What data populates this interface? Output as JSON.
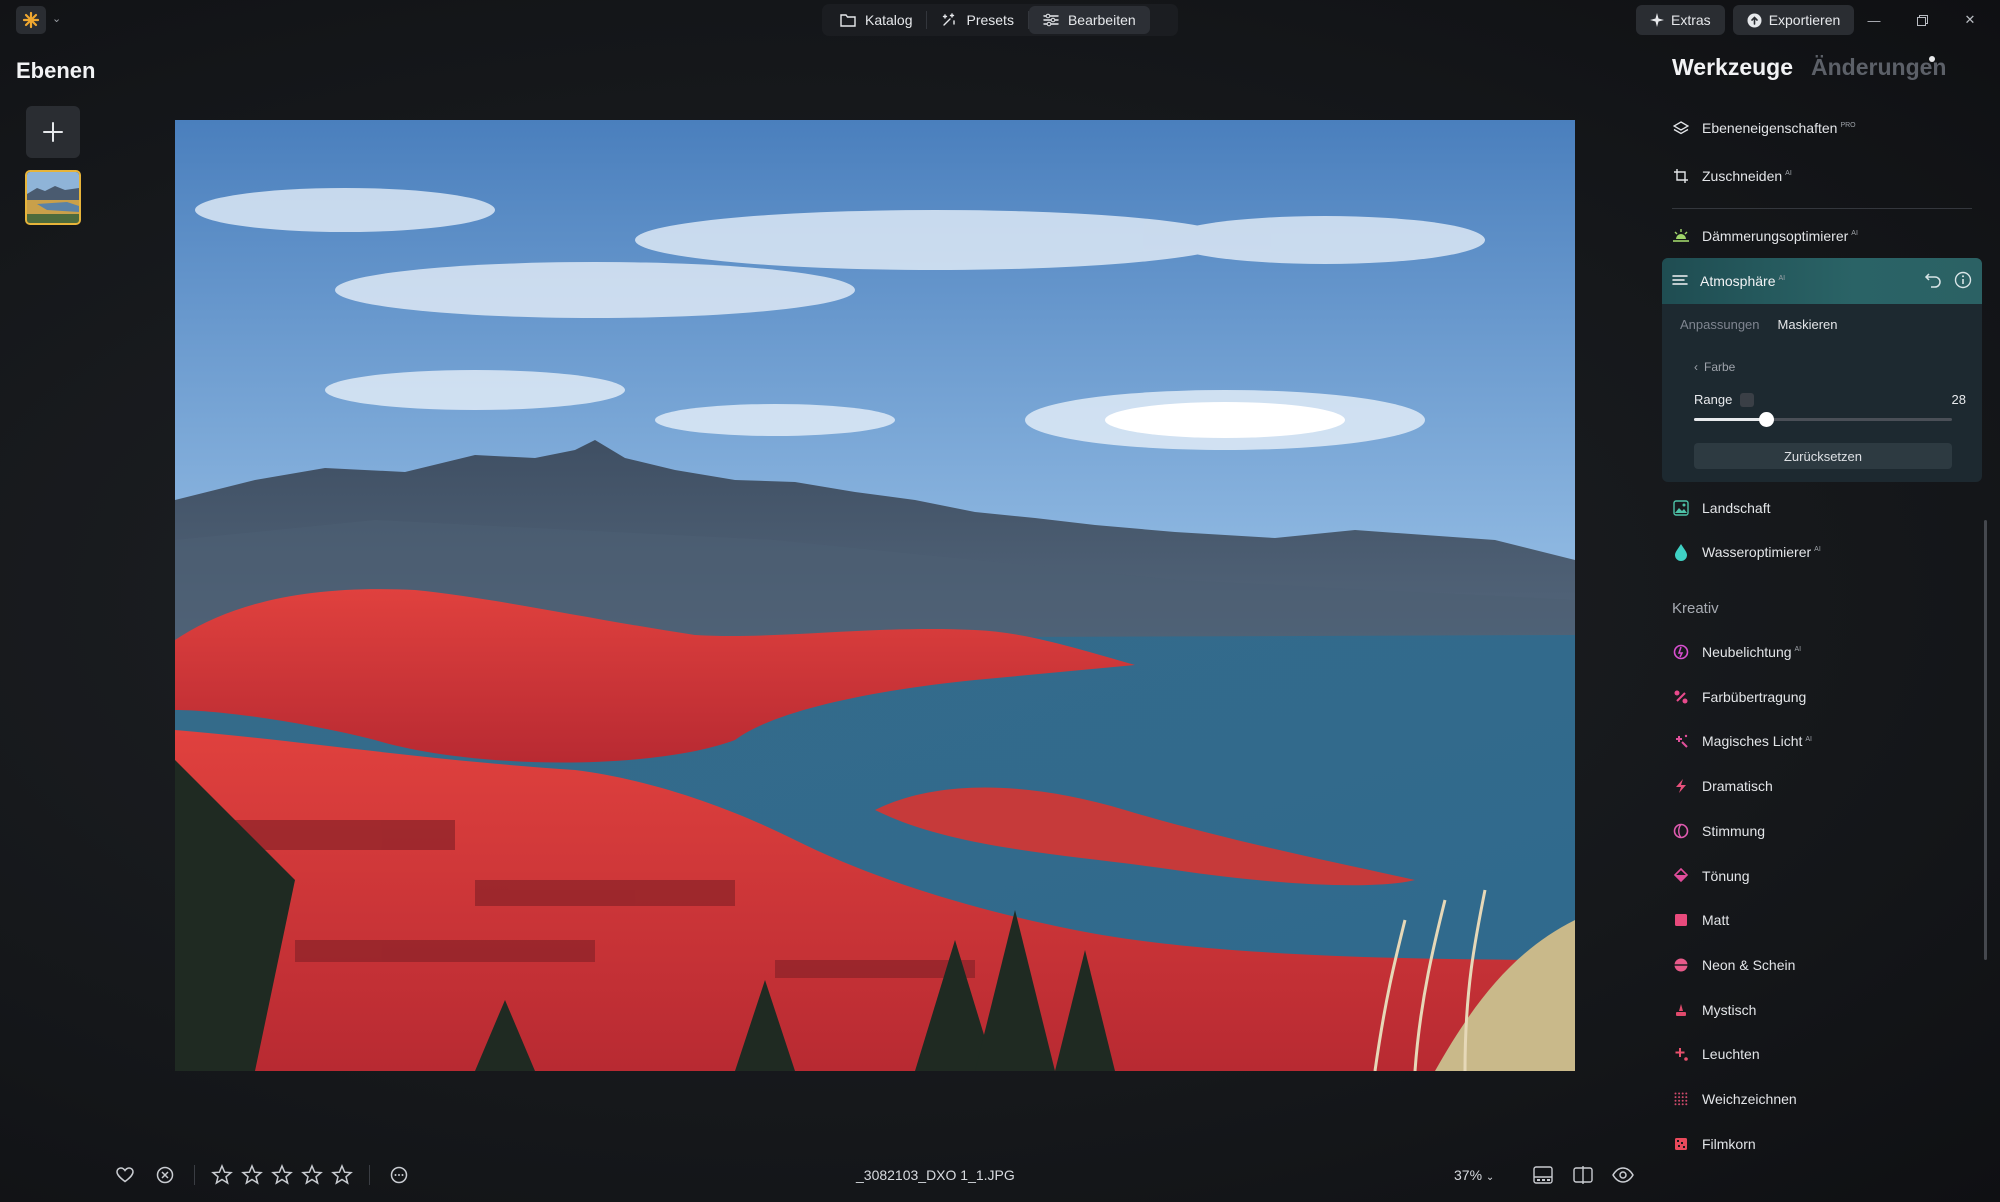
{
  "top_nav": {
    "items": [
      {
        "label": "Katalog",
        "icon": "folder-icon",
        "active": false
      },
      {
        "label": "Presets",
        "icon": "sparkle-icon",
        "active": false
      },
      {
        "label": "Bearbeiten",
        "icon": "sliders-icon",
        "active": true
      }
    ],
    "extras_label": "Extras",
    "export_label": "Exportieren"
  },
  "layers": {
    "title": "Ebenen"
  },
  "bottom_bar": {
    "filename": "_3082103_DXO 1_1.JPG",
    "zoom": "37%",
    "rating": 0
  },
  "right_panel": {
    "tabs": [
      {
        "label": "Werkzeuge",
        "active": true
      },
      {
        "label": "Änderungen",
        "active": false
      }
    ],
    "tools_top": [
      {
        "label": "Ebeneneigenschaften",
        "badge": "PRO",
        "icon": "layers-icon"
      },
      {
        "label": "Zuschneiden",
        "badge": "AI",
        "icon": "crop-icon"
      }
    ],
    "tools_mid": [
      {
        "label": "Dämmerungsoptimierer",
        "badge": "AI",
        "icon": "sunset-icon"
      }
    ],
    "atmosphere": {
      "title": "Atmosphäre",
      "badge": "AI",
      "subtabs": [
        "Anpassungen",
        "Maskieren"
      ],
      "active_subtab": "Maskieren",
      "back_label": "Farbe",
      "range_label": "Range",
      "range_value": "28",
      "range_fraction": 0.28,
      "reset_label": "Zurücksetzen"
    },
    "tools_after": [
      {
        "label": "Landschaft",
        "badge": "",
        "icon": "landscape-icon",
        "color": "#4ec3a8"
      },
      {
        "label": "Wasseroptimierer",
        "badge": "AI",
        "icon": "water-drop-icon",
        "color": "#3fd1c4"
      }
    ],
    "kreativ_label": "Kreativ",
    "kreativ_tools": [
      {
        "label": "Neubelichtung",
        "badge": "AI",
        "icon": "relight-icon",
        "color": "#d94fd0"
      },
      {
        "label": "Farbübertragung",
        "badge": "",
        "icon": "color-transfer-icon",
        "color": "#e84a8c"
      },
      {
        "label": "Magisches Licht",
        "badge": "AI",
        "icon": "magic-light-icon",
        "color": "#e0509a"
      },
      {
        "label": "Dramatisch",
        "badge": "",
        "icon": "lightning-icon",
        "color": "#e8507c"
      },
      {
        "label": "Stimmung",
        "badge": "",
        "icon": "mood-icon",
        "color": "#e05bb0"
      },
      {
        "label": "Tönung",
        "badge": "",
        "icon": "bucket-icon",
        "color": "#e04c9a"
      },
      {
        "label": "Matt",
        "badge": "",
        "icon": "matte-icon",
        "color": "#e84a7c"
      },
      {
        "label": "Neon & Schein",
        "badge": "",
        "icon": "neon-icon",
        "color": "#e85a8a"
      },
      {
        "label": "Mystisch",
        "badge": "",
        "icon": "mystic-icon",
        "color": "#e04a6c"
      },
      {
        "label": "Leuchten",
        "badge": "",
        "icon": "glow-icon",
        "color": "#e8506c"
      },
      {
        "label": "Weichzeichnen",
        "badge": "",
        "icon": "blur-icon",
        "color": "#d04a6c"
      },
      {
        "label": "Filmkorn",
        "badge": "",
        "icon": "film-grain-icon",
        "color": "#e84a5c"
      }
    ]
  },
  "colors": {
    "accent_teal": "#2a6366",
    "thumb_border": "#e7b43a",
    "logo": "#f0a830"
  }
}
